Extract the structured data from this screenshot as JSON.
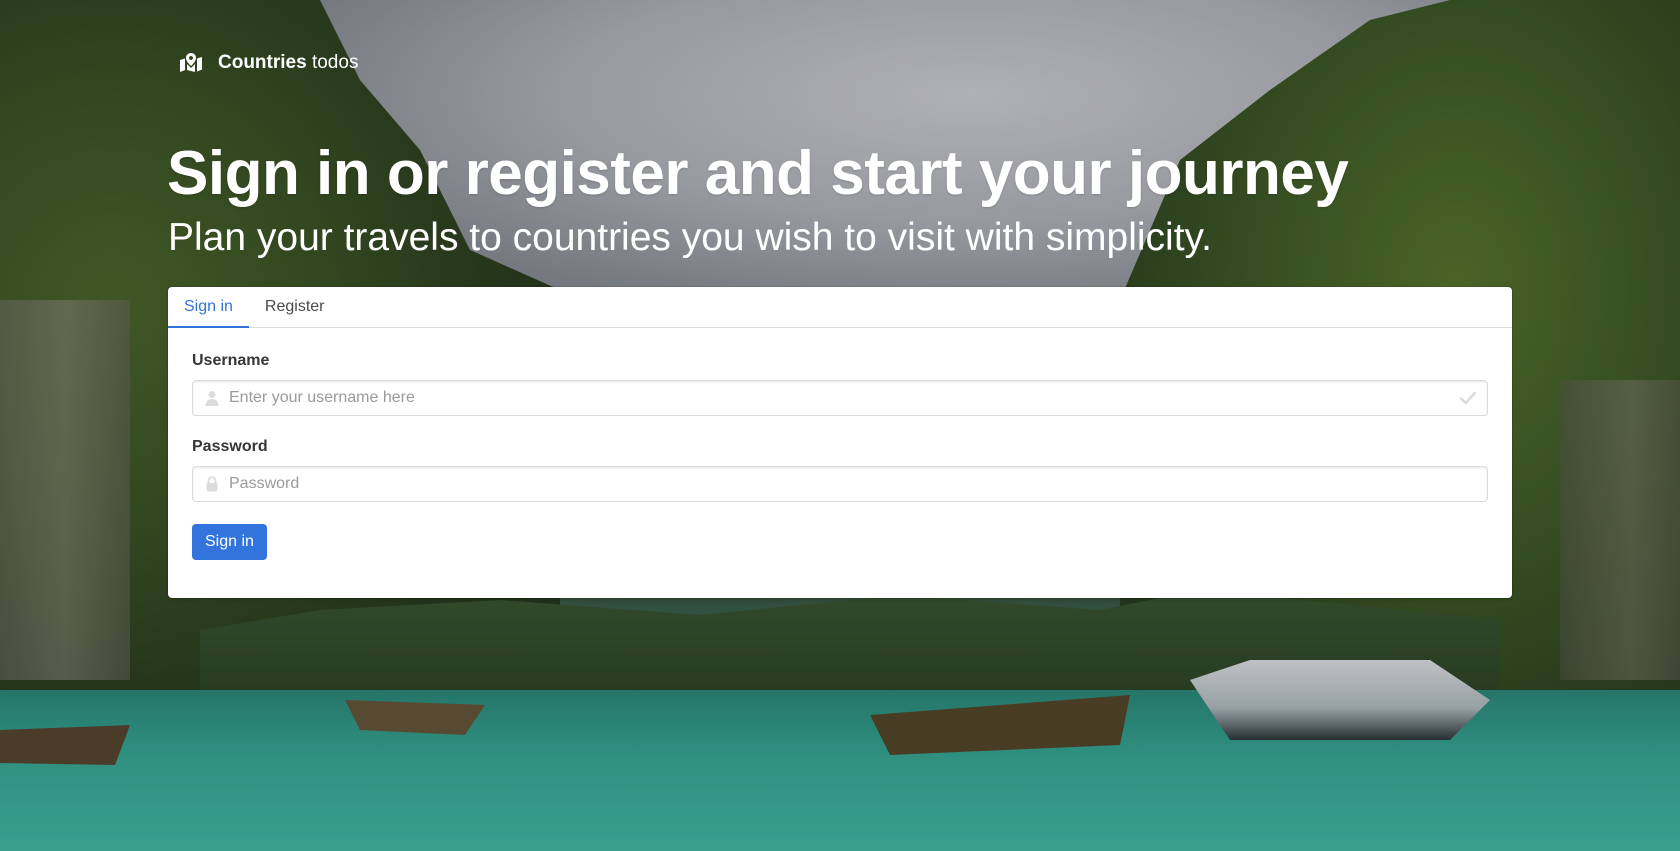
{
  "brand": {
    "name_bold": "Countries",
    "name_light": " todos",
    "icon": "map-marked-icon"
  },
  "hero": {
    "title": "Sign in or register and start your journey",
    "subtitle": "Plan your travels to countries you wish to visit with simplicity."
  },
  "tabs": [
    {
      "label": "Sign in",
      "active": true
    },
    {
      "label": "Register",
      "active": false
    }
  ],
  "form": {
    "username": {
      "label": "Username",
      "placeholder": "Enter your username here",
      "value": "",
      "icon_left": "user-icon",
      "icon_right": "check-icon"
    },
    "password": {
      "label": "Password",
      "placeholder": "Password",
      "value": "",
      "icon_left": "lock-icon"
    },
    "submit_label": "Sign in"
  },
  "colors": {
    "primary": "#3273dc",
    "text": "#363636",
    "muted_icon": "#dbdbdb",
    "white": "#ffffff"
  }
}
